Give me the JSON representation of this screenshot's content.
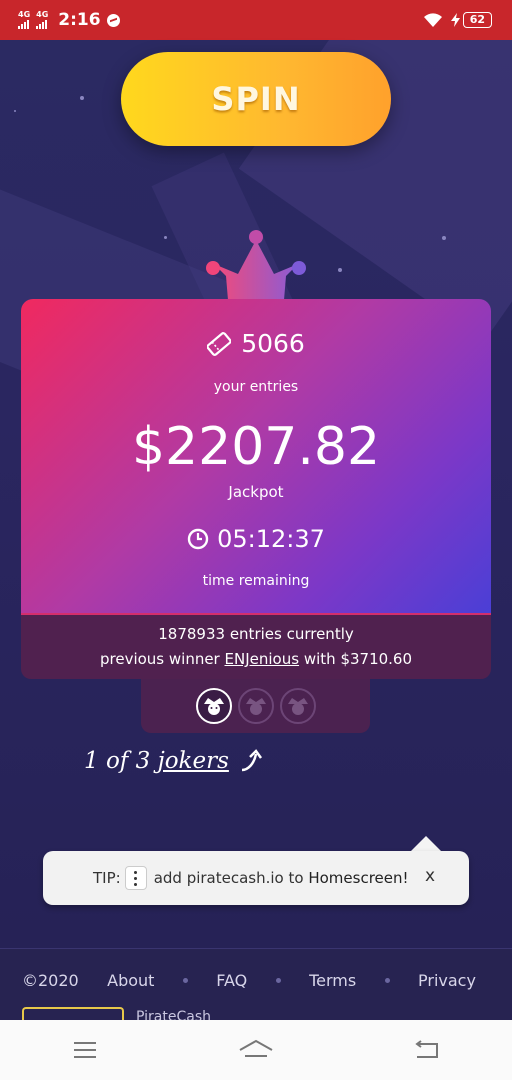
{
  "status_bar": {
    "network_1": "4G",
    "network_2": "4G",
    "time": "2:16",
    "battery": "62"
  },
  "spin": {
    "label": "SPIN"
  },
  "card": {
    "entries_value": "5066",
    "entries_label": "your entries",
    "jackpot_amount": "$2207.82",
    "jackpot_label": "Jackpot",
    "timer_value": "05:12:37",
    "timer_label": "time remaining"
  },
  "stats": {
    "entries_line": "1878933 entries currently",
    "winner_prefix": "previous winner",
    "winner_name": "ENJenious",
    "winner_with": "with",
    "winner_amount": "$3710.60"
  },
  "jokers": {
    "count_prefix": "1 of 3",
    "link_label": "jokers",
    "tokens": [
      "joker-active",
      "joker-inactive",
      "joker-inactive"
    ]
  },
  "tip": {
    "label": "TIP:",
    "text_before": "add piratecash.io to",
    "text_strong": "Homescreen!",
    "close": "x"
  },
  "footer": {
    "copyright": "©2020",
    "links": [
      "About",
      "FAQ",
      "Terms",
      "Privacy"
    ],
    "brand_name": "PirateCash"
  },
  "colors": {
    "status_bar": "#c8262b",
    "background": "#2a2458",
    "spin_gradient_start": "#ffd81d",
    "spin_gradient_end": "#ffa12c",
    "card_gradient_start": "#f0295f",
    "card_gradient_end": "#4a3fd6",
    "card_footer": "#50214f"
  }
}
